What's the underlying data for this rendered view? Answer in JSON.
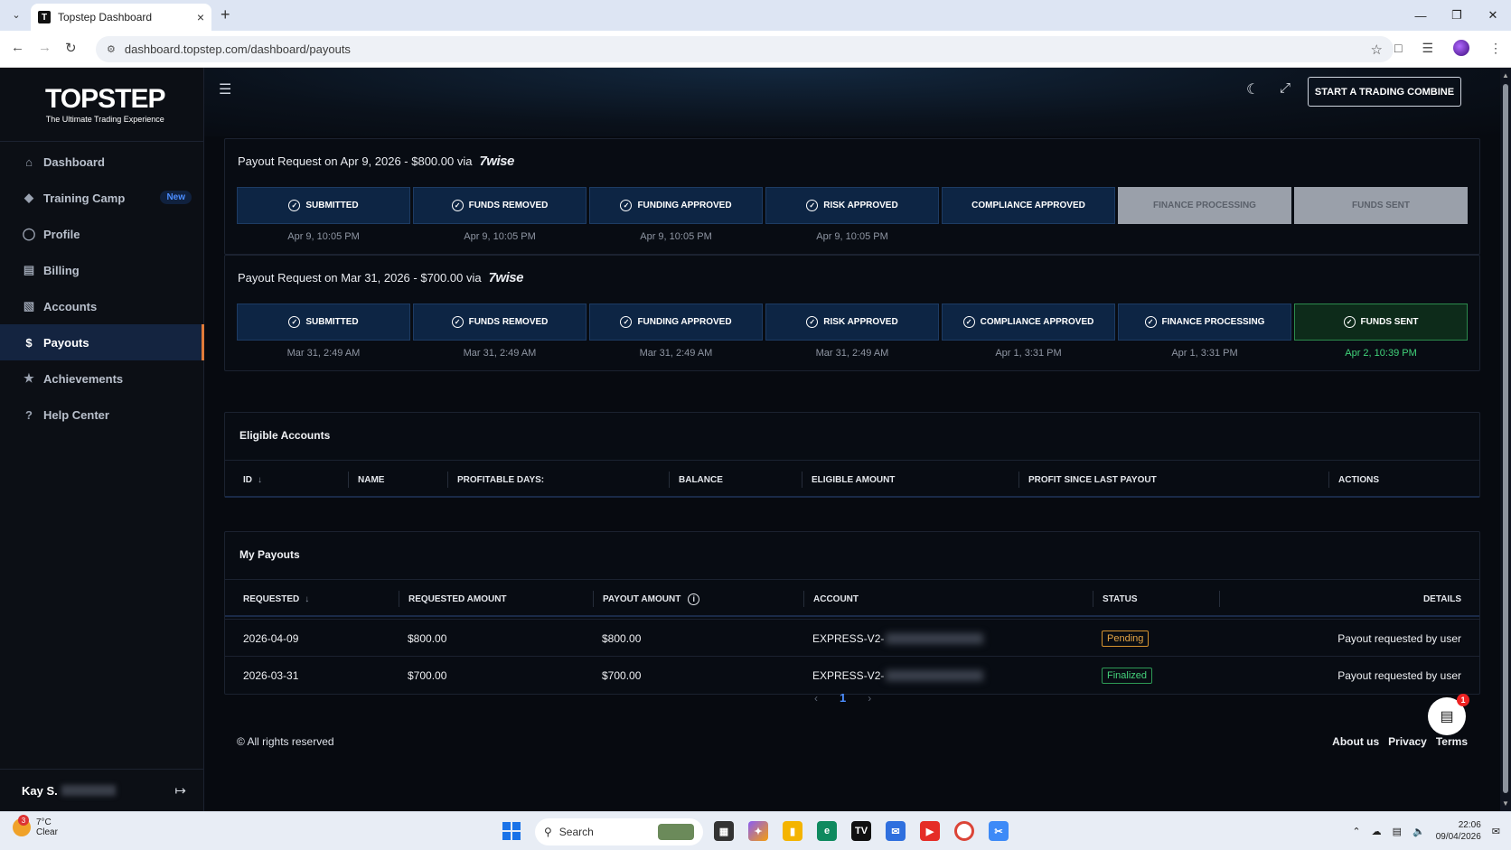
{
  "browser": {
    "tab_title": "Topstep Dashboard",
    "url": "dashboard.topstep.com/dashboard/payouts",
    "new_tab": "+",
    "close_tab": "×"
  },
  "app": {
    "logo_name": "TOPSTEP",
    "logo_tagline": "The Ultimate Trading Experience",
    "cta_label": "START A TRADING COMBINE"
  },
  "sidebar": {
    "items": [
      {
        "label": "Dashboard",
        "icon": "home-icon"
      },
      {
        "label": "Training Camp",
        "icon": "graduation-cap-icon",
        "badge": "New"
      },
      {
        "label": "Profile",
        "icon": "profile-icon"
      },
      {
        "label": "Billing",
        "icon": "billing-icon"
      },
      {
        "label": "Accounts",
        "icon": "accounts-chart-icon"
      },
      {
        "label": "Payouts",
        "icon": "dollar-icon",
        "active": true
      },
      {
        "label": "Achievements",
        "icon": "trophy-icon"
      },
      {
        "label": "Help Center",
        "icon": "help-icon"
      }
    ],
    "user_name": "Kay S."
  },
  "payout_requests": [
    {
      "title": "Payout Request on Apr 9, 2026 - $800.00 via",
      "provider": "7wise",
      "steps": [
        {
          "label": "SUBMITTED",
          "state": "done",
          "date": "Apr 9, 10:05 PM"
        },
        {
          "label": "FUNDS REMOVED",
          "state": "done",
          "date": "Apr 9, 10:05 PM"
        },
        {
          "label": "FUNDING APPROVED",
          "state": "done",
          "date": "Apr 9, 10:05 PM"
        },
        {
          "label": "RISK APPROVED",
          "state": "done",
          "date": "Apr 9, 10:05 PM"
        },
        {
          "label": "COMPLIANCE APPROVED",
          "state": "done-nocheck",
          "date": ""
        },
        {
          "label": "FINANCE PROCESSING",
          "state": "pending",
          "date": ""
        },
        {
          "label": "FUNDS SENT",
          "state": "pending",
          "date": ""
        }
      ]
    },
    {
      "title": "Payout Request on Mar 31, 2026 - $700.00 via",
      "provider": "7wise",
      "steps": [
        {
          "label": "SUBMITTED",
          "state": "done",
          "date": "Mar 31, 2:49 AM"
        },
        {
          "label": "FUNDS REMOVED",
          "state": "done",
          "date": "Mar 31, 2:49 AM"
        },
        {
          "label": "FUNDING APPROVED",
          "state": "done",
          "date": "Mar 31, 2:49 AM"
        },
        {
          "label": "RISK APPROVED",
          "state": "done",
          "date": "Mar 31, 2:49 AM"
        },
        {
          "label": "COMPLIANCE APPROVED",
          "state": "done",
          "date": "Apr 1, 3:31 PM"
        },
        {
          "label": "FINANCE PROCESSING",
          "state": "done",
          "date": "Apr 1, 3:31 PM"
        },
        {
          "label": "FUNDS SENT",
          "state": "sent",
          "date": "Apr 2, 10:39 PM"
        }
      ]
    }
  ],
  "eligible": {
    "title": "Eligible Accounts",
    "columns": [
      "ID",
      "NAME",
      "PROFITABLE DAYS:",
      "BALANCE",
      "ELIGIBLE AMOUNT",
      "PROFIT SINCE LAST PAYOUT",
      "ACTIONS"
    ]
  },
  "payouts": {
    "title": "My Payouts",
    "columns": [
      "REQUESTED",
      "REQUESTED AMOUNT",
      "PAYOUT AMOUNT",
      "ACCOUNT",
      "STATUS",
      "DETAILS"
    ],
    "rows": [
      {
        "requested": "2026-04-09",
        "requested_amount": "$800.00",
        "payout_amount": "$800.00",
        "account": "EXPRESS-V2-",
        "status": "Pending",
        "details": "Payout requested by user"
      },
      {
        "requested": "2026-03-31",
        "requested_amount": "$700.00",
        "payout_amount": "$700.00",
        "account": "EXPRESS-V2-",
        "status": "Finalized",
        "details": "Payout requested by user"
      }
    ]
  },
  "pagination": {
    "current": "1"
  },
  "footer": {
    "copyright": "© All rights reserved",
    "links": [
      "About us",
      "Privacy",
      "Terms"
    ]
  },
  "chat": {
    "notification_count": "1"
  },
  "taskbar": {
    "temp": "7°C",
    "weather": "Clear",
    "weather_badge": "3",
    "search_placeholder": "Search",
    "time": "22:06",
    "date": "09/04/2026"
  },
  "colors": {
    "accent_blue": "#4c8dff",
    "active_border": "#e07b39",
    "pending": "#e5a545",
    "finalized": "#45d27b"
  }
}
